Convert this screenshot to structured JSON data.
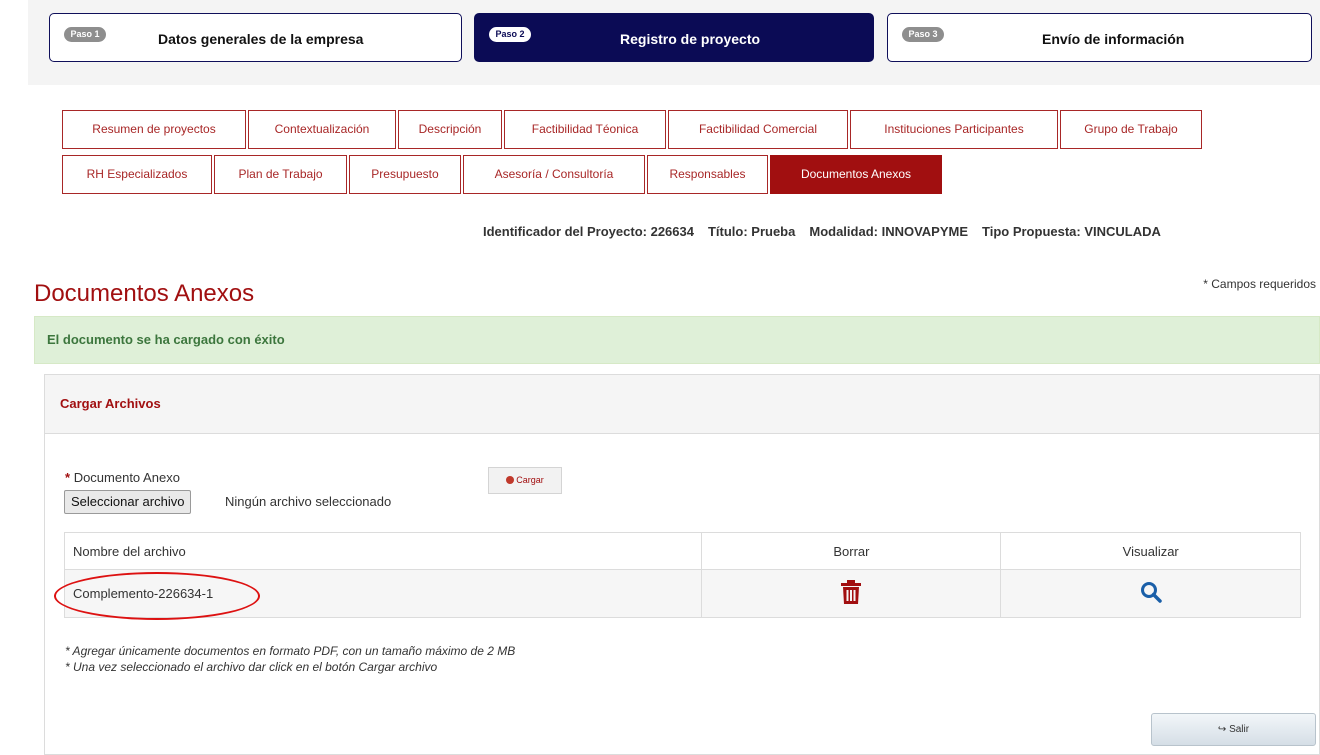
{
  "steps": [
    {
      "badge": "Paso 1",
      "label": "Datos generales de la empresa"
    },
    {
      "badge": "Paso 2",
      "label": "Registro de proyecto"
    },
    {
      "badge": "Paso 3",
      "label": "Envío de información"
    }
  ],
  "tabs": [
    "Resumen de proyectos",
    "Contextualización",
    "Descripción",
    "Factibilidad Téonica",
    "Factibilidad Comercial",
    "Instituciones Participantes",
    "Grupo de Trabajo",
    "RH Especializados",
    "Plan de Trabajo",
    "Presupuesto",
    "Asesoría / Consultoría",
    "Responsables",
    "Documentos Anexos"
  ],
  "project_info": {
    "id_label": "Identificador del Proyecto: 226634",
    "title_label": "Título: Prueba",
    "mode_label": "Modalidad: INNOVAPYME",
    "type_label": "Tipo Propuesta: VINCULADA"
  },
  "required_note": "* Campos requeridos",
  "page_title": "Documentos Anexos",
  "alert_text": "El documento se ha cargado con éxito",
  "panel_title": "Cargar Archivos",
  "field": {
    "required_mark": "*",
    "label": "Documento Anexo",
    "file_button": "Seleccionar archivo",
    "file_status": "Ningún archivo seleccionado"
  },
  "upload_label": "Cargar",
  "table": {
    "headers": [
      "Nombre del archivo",
      "Borrar",
      "Visualizar"
    ],
    "rows": [
      {
        "name": "Complemento-226634-1"
      }
    ]
  },
  "notes": [
    "* Agregar únicamente documentos en formato PDF, con un tamaño máximo de 2 MB",
    "* Una vez seleccionado el archivo dar click en el botón Cargar archivo"
  ],
  "exit_label": "Salir",
  "colors": {
    "navy": "#0b0b55",
    "brand_red": "#a10f10",
    "success_bg": "#dff0d8",
    "icon_blue": "#1a5fa8"
  },
  "icons": {
    "delete": "trash-icon",
    "view": "search-icon",
    "upload": "plus-circle-icon",
    "exit": "exit-icon"
  }
}
